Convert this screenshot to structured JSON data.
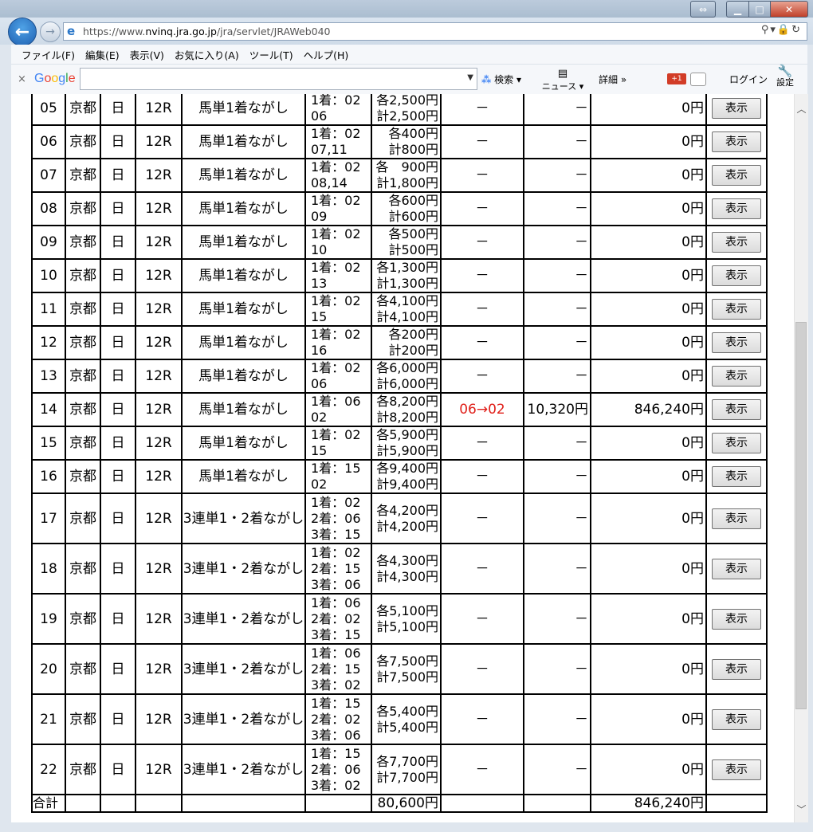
{
  "browser": {
    "url_prefix": "https://www.",
    "url_domain": "nvinq.jra.go.jp",
    "url_path": "/jra/servlet/JRAWeb040",
    "menu": [
      "ファイル(F)",
      "編集(E)",
      "表示(V)",
      "お気に入り(A)",
      "ツール(T)",
      "ヘルプ(H)"
    ],
    "google": {
      "close": "×",
      "logo": "Google",
      "search_label": "検索",
      "news_label": "ニュース",
      "detail_label": "詳細 »",
      "plus_label": "+1",
      "login_label": "ログイン",
      "settings_label": "設定"
    }
  },
  "table": {
    "show_label": "表示",
    "rows": [
      {
        "no": "05",
        "place": "京都",
        "day": "日",
        "race": "12R",
        "type": "馬単1着ながし",
        "kumi": [
          "1着：02",
          "06"
        ],
        "amt": [
          "各2,500円",
          "計2,500円"
        ],
        "hit": "－",
        "odds": "－",
        "pay": "0円",
        "red": false
      },
      {
        "no": "06",
        "place": "京都",
        "day": "日",
        "race": "12R",
        "type": "馬単1着ながし",
        "kumi": [
          "1着：02",
          "07,11"
        ],
        "amt": [
          "各400円",
          "計800円"
        ],
        "hit": "－",
        "odds": "－",
        "pay": "0円",
        "red": false
      },
      {
        "no": "07",
        "place": "京都",
        "day": "日",
        "race": "12R",
        "type": "馬単1着ながし",
        "kumi": [
          "1着：02",
          "08,14"
        ],
        "amt": [
          "各　900円",
          "計1,800円"
        ],
        "hit": "－",
        "odds": "－",
        "pay": "0円",
        "red": false
      },
      {
        "no": "08",
        "place": "京都",
        "day": "日",
        "race": "12R",
        "type": "馬単1着ながし",
        "kumi": [
          "1着：02",
          "09"
        ],
        "amt": [
          "各600円",
          "計600円"
        ],
        "hit": "－",
        "odds": "－",
        "pay": "0円",
        "red": false
      },
      {
        "no": "09",
        "place": "京都",
        "day": "日",
        "race": "12R",
        "type": "馬単1着ながし",
        "kumi": [
          "1着：02",
          "10"
        ],
        "amt": [
          "各500円",
          "計500円"
        ],
        "hit": "－",
        "odds": "－",
        "pay": "0円",
        "red": false
      },
      {
        "no": "10",
        "place": "京都",
        "day": "日",
        "race": "12R",
        "type": "馬単1着ながし",
        "kumi": [
          "1着：02",
          "13"
        ],
        "amt": [
          "各1,300円",
          "計1,300円"
        ],
        "hit": "－",
        "odds": "－",
        "pay": "0円",
        "red": false
      },
      {
        "no": "11",
        "place": "京都",
        "day": "日",
        "race": "12R",
        "type": "馬単1着ながし",
        "kumi": [
          "1着：02",
          "15"
        ],
        "amt": [
          "各4,100円",
          "計4,100円"
        ],
        "hit": "－",
        "odds": "－",
        "pay": "0円",
        "red": false
      },
      {
        "no": "12",
        "place": "京都",
        "day": "日",
        "race": "12R",
        "type": "馬単1着ながし",
        "kumi": [
          "1着：02",
          "16"
        ],
        "amt": [
          "各200円",
          "計200円"
        ],
        "hit": "－",
        "odds": "－",
        "pay": "0円",
        "red": false
      },
      {
        "no": "13",
        "place": "京都",
        "day": "日",
        "race": "12R",
        "type": "馬単1着ながし",
        "kumi": [
          "1着：02",
          "06"
        ],
        "amt": [
          "各6,000円",
          "計6,000円"
        ],
        "hit": "－",
        "odds": "－",
        "pay": "0円",
        "red": false
      },
      {
        "no": "14",
        "place": "京都",
        "day": "日",
        "race": "12R",
        "type": "馬単1着ながし",
        "kumi": [
          "1着：06",
          "02"
        ],
        "amt": [
          "各8,200円",
          "計8,200円"
        ],
        "hit": "06→02",
        "odds": "10,320円",
        "pay": "846,240円",
        "red": true
      },
      {
        "no": "15",
        "place": "京都",
        "day": "日",
        "race": "12R",
        "type": "馬単1着ながし",
        "kumi": [
          "1着：02",
          "15"
        ],
        "amt": [
          "各5,900円",
          "計5,900円"
        ],
        "hit": "－",
        "odds": "－",
        "pay": "0円",
        "red": false
      },
      {
        "no": "16",
        "place": "京都",
        "day": "日",
        "race": "12R",
        "type": "馬単1着ながし",
        "kumi": [
          "1着：15",
          "02"
        ],
        "amt": [
          "各9,400円",
          "計9,400円"
        ],
        "hit": "－",
        "odds": "－",
        "pay": "0円",
        "red": false
      },
      {
        "no": "17",
        "place": "京都",
        "day": "日",
        "race": "12R",
        "type": "3連単1・2着ながし",
        "kumi": [
          "1着：02",
          "2着：06",
          "3着：15"
        ],
        "amt": [
          "各4,200円",
          "計4,200円"
        ],
        "hit": "－",
        "odds": "－",
        "pay": "0円",
        "red": false
      },
      {
        "no": "18",
        "place": "京都",
        "day": "日",
        "race": "12R",
        "type": "3連単1・2着ながし",
        "kumi": [
          "1着：02",
          "2着：15",
          "3着：06"
        ],
        "amt": [
          "各4,300円",
          "計4,300円"
        ],
        "hit": "－",
        "odds": "－",
        "pay": "0円",
        "red": false
      },
      {
        "no": "19",
        "place": "京都",
        "day": "日",
        "race": "12R",
        "type": "3連単1・2着ながし",
        "kumi": [
          "1着：06",
          "2着：02",
          "3着：15"
        ],
        "amt": [
          "各5,100円",
          "計5,100円"
        ],
        "hit": "－",
        "odds": "－",
        "pay": "0円",
        "red": false
      },
      {
        "no": "20",
        "place": "京都",
        "day": "日",
        "race": "12R",
        "type": "3連単1・2着ながし",
        "kumi": [
          "1着：06",
          "2着：15",
          "3着：02"
        ],
        "amt": [
          "各7,500円",
          "計7,500円"
        ],
        "hit": "－",
        "odds": "－",
        "pay": "0円",
        "red": false
      },
      {
        "no": "21",
        "place": "京都",
        "day": "日",
        "race": "12R",
        "type": "3連単1・2着ながし",
        "kumi": [
          "1着：15",
          "2着：02",
          "3着：06"
        ],
        "amt": [
          "各5,400円",
          "計5,400円"
        ],
        "hit": "－",
        "odds": "－",
        "pay": "0円",
        "red": false
      },
      {
        "no": "22",
        "place": "京都",
        "day": "日",
        "race": "12R",
        "type": "3連単1・2着ながし",
        "kumi": [
          "1着：15",
          "2着：06",
          "3着：02"
        ],
        "amt": [
          "各7,700円",
          "計7,700円"
        ],
        "hit": "－",
        "odds": "－",
        "pay": "0円",
        "red": false
      }
    ],
    "total": {
      "label": "合計",
      "amt": "80,600円",
      "pay": "846,240円"
    }
  },
  "colors": {
    "hit_red": "#e0201a",
    "close_red": "#c0402a"
  }
}
